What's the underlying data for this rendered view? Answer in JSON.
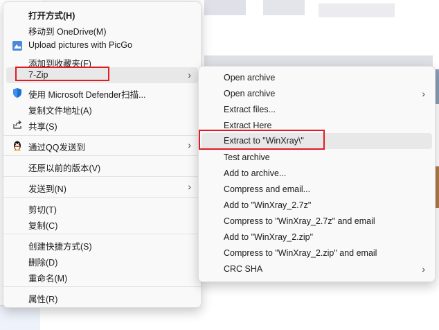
{
  "main_menu": {
    "items": [
      {
        "label": "打开方式(H)"
      },
      {
        "label": "移动到 OneDrive(M)"
      },
      {
        "label": "Upload pictures with PicGo"
      },
      {
        "label": "添加到收藏夹(F)"
      },
      {
        "label": "7-Zip"
      },
      {
        "label": "使用 Microsoft Defender扫描..."
      },
      {
        "label": "复制文件地址(A)"
      },
      {
        "label": "共享(S)"
      },
      {
        "label": "通过QQ发送到"
      },
      {
        "label": "还原以前的版本(V)"
      },
      {
        "label": "发送到(N)"
      },
      {
        "label": "剪切(T)"
      },
      {
        "label": "复制(C)"
      },
      {
        "label": "创建快捷方式(S)"
      },
      {
        "label": "删除(D)"
      },
      {
        "label": "重命名(M)"
      },
      {
        "label": "属性(R)"
      }
    ]
  },
  "sub_menu": {
    "items": [
      {
        "label": "Open archive"
      },
      {
        "label": "Open archive"
      },
      {
        "label": "Extract files..."
      },
      {
        "label": "Extract Here"
      },
      {
        "label": "Extract to \"WinXray\\\""
      },
      {
        "label": "Test archive"
      },
      {
        "label": "Add to archive..."
      },
      {
        "label": "Compress and email..."
      },
      {
        "label": "Add to \"WinXray_2.7z\""
      },
      {
        "label": "Compress to \"WinXray_2.7z\" and email"
      },
      {
        "label": "Add to \"WinXray_2.zip\""
      },
      {
        "label": "Compress to \"WinXray_2.zip\" and email"
      },
      {
        "label": "CRC SHA"
      }
    ]
  },
  "submenu_arrow": "›",
  "colors": {
    "highlight_box": "#e01b24",
    "menu_bg": "#f9f9f9",
    "hover": "#e8e8e8"
  }
}
